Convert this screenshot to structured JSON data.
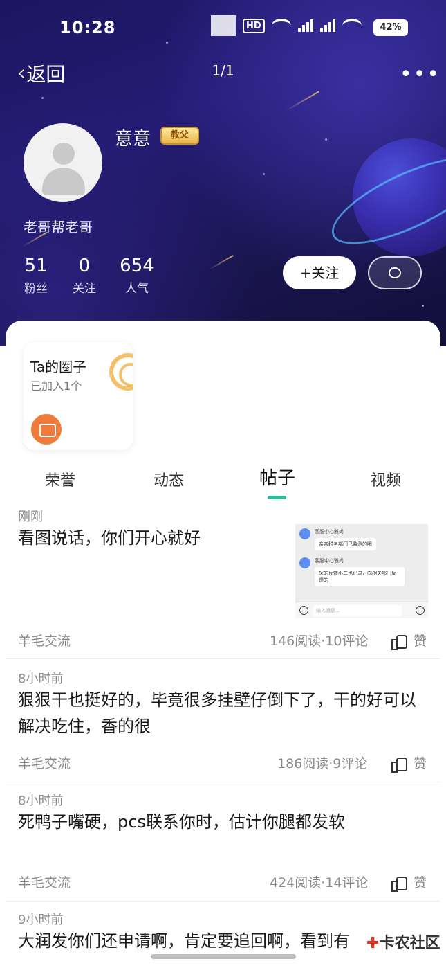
{
  "status_bar": {
    "time": "10:28",
    "battery": "42%"
  },
  "nav": {
    "back_label": "返回",
    "page_indicator": "1/1"
  },
  "profile": {
    "username": "意意",
    "badge": "教父",
    "bio": "老哥帮老哥",
    "stats": [
      {
        "value": "51",
        "label": "粉丝"
      },
      {
        "value": "0",
        "label": "关注"
      },
      {
        "value": "654",
        "label": "人气"
      }
    ],
    "follow_label": "+关注"
  },
  "circle_card": {
    "title": "Ta的圈子",
    "subtitle": "已加入1个"
  },
  "tabs": [
    {
      "label": "荣誉"
    },
    {
      "label": "动态"
    },
    {
      "label": "帖子",
      "active": true
    },
    {
      "label": "视频"
    }
  ],
  "posts": [
    {
      "time": "刚刚",
      "content": "看图说话，你们开心就好",
      "circle": "羊毛交流",
      "stats": "146阅读·10评论",
      "like": "赞",
      "screenshot": {
        "sender1": "客服中心雅尚",
        "msg1": "亲亲税务部门已监测的哦",
        "sender2": "客服中心雅尚",
        "msg2": "您的反馈小二也记录，向相关部门反馈的",
        "input_placeholder": "输入消息..."
      }
    },
    {
      "time": "8小时前",
      "content": "狠狠干也挺好的，毕竟很多挂壁仔倒下了，干的好可以解决吃住，香的很",
      "circle": "羊毛交流",
      "stats": "186阅读·9评论",
      "like": "赞"
    },
    {
      "time": "8小时前",
      "content": "死鸭子嘴硬，pcs联系你时，估计你腿都发软",
      "circle": "羊毛交流",
      "stats": "424阅读·14评论",
      "like": "赞"
    },
    {
      "time": "9小时前",
      "content": "大润发你们还申请啊，肯定要追回啊，看到有"
    }
  ],
  "watermark": "卡农社区"
}
